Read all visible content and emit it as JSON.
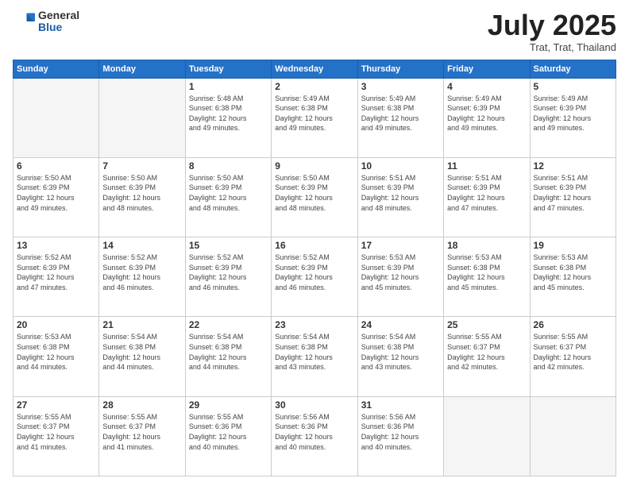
{
  "header": {
    "logo_general": "General",
    "logo_blue": "Blue",
    "month_title": "July 2025",
    "location": "Trat, Trat, Thailand"
  },
  "weekdays": [
    "Sunday",
    "Monday",
    "Tuesday",
    "Wednesday",
    "Thursday",
    "Friday",
    "Saturday"
  ],
  "weeks": [
    [
      {
        "day": "",
        "info": ""
      },
      {
        "day": "",
        "info": ""
      },
      {
        "day": "1",
        "info": "Sunrise: 5:48 AM\nSunset: 6:38 PM\nDaylight: 12 hours\nand 49 minutes."
      },
      {
        "day": "2",
        "info": "Sunrise: 5:49 AM\nSunset: 6:38 PM\nDaylight: 12 hours\nand 49 minutes."
      },
      {
        "day": "3",
        "info": "Sunrise: 5:49 AM\nSunset: 6:38 PM\nDaylight: 12 hours\nand 49 minutes."
      },
      {
        "day": "4",
        "info": "Sunrise: 5:49 AM\nSunset: 6:39 PM\nDaylight: 12 hours\nand 49 minutes."
      },
      {
        "day": "5",
        "info": "Sunrise: 5:49 AM\nSunset: 6:39 PM\nDaylight: 12 hours\nand 49 minutes."
      }
    ],
    [
      {
        "day": "6",
        "info": "Sunrise: 5:50 AM\nSunset: 6:39 PM\nDaylight: 12 hours\nand 49 minutes."
      },
      {
        "day": "7",
        "info": "Sunrise: 5:50 AM\nSunset: 6:39 PM\nDaylight: 12 hours\nand 48 minutes."
      },
      {
        "day": "8",
        "info": "Sunrise: 5:50 AM\nSunset: 6:39 PM\nDaylight: 12 hours\nand 48 minutes."
      },
      {
        "day": "9",
        "info": "Sunrise: 5:50 AM\nSunset: 6:39 PM\nDaylight: 12 hours\nand 48 minutes."
      },
      {
        "day": "10",
        "info": "Sunrise: 5:51 AM\nSunset: 6:39 PM\nDaylight: 12 hours\nand 48 minutes."
      },
      {
        "day": "11",
        "info": "Sunrise: 5:51 AM\nSunset: 6:39 PM\nDaylight: 12 hours\nand 47 minutes."
      },
      {
        "day": "12",
        "info": "Sunrise: 5:51 AM\nSunset: 6:39 PM\nDaylight: 12 hours\nand 47 minutes."
      }
    ],
    [
      {
        "day": "13",
        "info": "Sunrise: 5:52 AM\nSunset: 6:39 PM\nDaylight: 12 hours\nand 47 minutes."
      },
      {
        "day": "14",
        "info": "Sunrise: 5:52 AM\nSunset: 6:39 PM\nDaylight: 12 hours\nand 46 minutes."
      },
      {
        "day": "15",
        "info": "Sunrise: 5:52 AM\nSunset: 6:39 PM\nDaylight: 12 hours\nand 46 minutes."
      },
      {
        "day": "16",
        "info": "Sunrise: 5:52 AM\nSunset: 6:39 PM\nDaylight: 12 hours\nand 46 minutes."
      },
      {
        "day": "17",
        "info": "Sunrise: 5:53 AM\nSunset: 6:39 PM\nDaylight: 12 hours\nand 45 minutes."
      },
      {
        "day": "18",
        "info": "Sunrise: 5:53 AM\nSunset: 6:38 PM\nDaylight: 12 hours\nand 45 minutes."
      },
      {
        "day": "19",
        "info": "Sunrise: 5:53 AM\nSunset: 6:38 PM\nDaylight: 12 hours\nand 45 minutes."
      }
    ],
    [
      {
        "day": "20",
        "info": "Sunrise: 5:53 AM\nSunset: 6:38 PM\nDaylight: 12 hours\nand 44 minutes."
      },
      {
        "day": "21",
        "info": "Sunrise: 5:54 AM\nSunset: 6:38 PM\nDaylight: 12 hours\nand 44 minutes."
      },
      {
        "day": "22",
        "info": "Sunrise: 5:54 AM\nSunset: 6:38 PM\nDaylight: 12 hours\nand 44 minutes."
      },
      {
        "day": "23",
        "info": "Sunrise: 5:54 AM\nSunset: 6:38 PM\nDaylight: 12 hours\nand 43 minutes."
      },
      {
        "day": "24",
        "info": "Sunrise: 5:54 AM\nSunset: 6:38 PM\nDaylight: 12 hours\nand 43 minutes."
      },
      {
        "day": "25",
        "info": "Sunrise: 5:55 AM\nSunset: 6:37 PM\nDaylight: 12 hours\nand 42 minutes."
      },
      {
        "day": "26",
        "info": "Sunrise: 5:55 AM\nSunset: 6:37 PM\nDaylight: 12 hours\nand 42 minutes."
      }
    ],
    [
      {
        "day": "27",
        "info": "Sunrise: 5:55 AM\nSunset: 6:37 PM\nDaylight: 12 hours\nand 41 minutes."
      },
      {
        "day": "28",
        "info": "Sunrise: 5:55 AM\nSunset: 6:37 PM\nDaylight: 12 hours\nand 41 minutes."
      },
      {
        "day": "29",
        "info": "Sunrise: 5:55 AM\nSunset: 6:36 PM\nDaylight: 12 hours\nand 40 minutes."
      },
      {
        "day": "30",
        "info": "Sunrise: 5:56 AM\nSunset: 6:36 PM\nDaylight: 12 hours\nand 40 minutes."
      },
      {
        "day": "31",
        "info": "Sunrise: 5:56 AM\nSunset: 6:36 PM\nDaylight: 12 hours\nand 40 minutes."
      },
      {
        "day": "",
        "info": ""
      },
      {
        "day": "",
        "info": ""
      }
    ]
  ]
}
